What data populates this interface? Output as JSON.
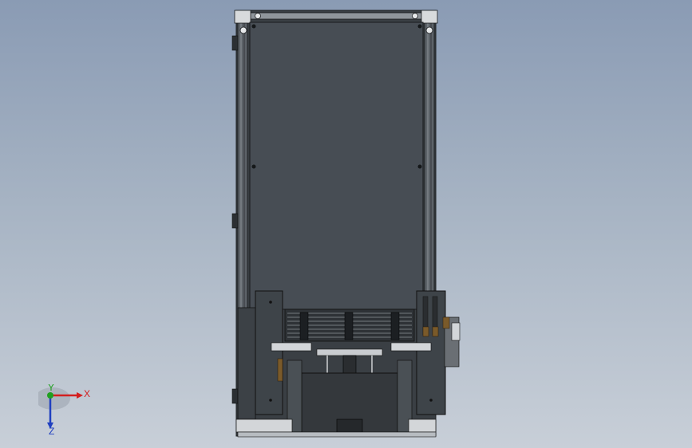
{
  "viewport": {
    "background_top": "#8a9bb4",
    "background_bottom": "#c8cfd8"
  },
  "model": {
    "frame_color": "#2b2f33",
    "panel_color": "#474d54",
    "accent_brown": "#7a5a2a",
    "label_note": ""
  },
  "triad": {
    "x_label": "X",
    "y_label": "Y",
    "z_label": "Z",
    "x_color": "#d32020",
    "y_color": "#20a020",
    "z_color": "#2040c0"
  }
}
